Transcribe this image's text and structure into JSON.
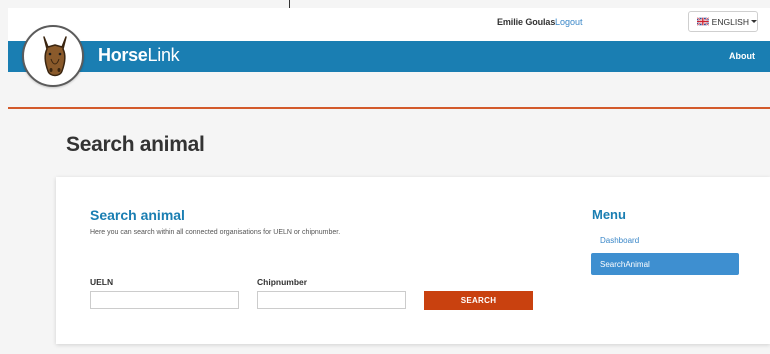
{
  "topbar": {
    "user_name": "Emilie Goulas",
    "logout_label": "Logout",
    "language_label": "ENGLISH"
  },
  "navbar": {
    "brand_bold": "Horse",
    "brand_light": "Link",
    "about_label": "About"
  },
  "page": {
    "title": "Search animal"
  },
  "search_card": {
    "title": "Search animal",
    "description": "Here you can search within all connected organisations for UELN or chipnumber.",
    "ueln_label": "UELN",
    "ueln_value": "",
    "chip_label": "Chipnumber",
    "chip_value": "",
    "search_label": "SEARCH"
  },
  "menu": {
    "title": "Menu",
    "items": [
      {
        "label": "Dashboard",
        "active": false
      },
      {
        "label": "SearchAnimal",
        "active": true
      }
    ]
  },
  "colors": {
    "brand_blue": "#1a7eb2",
    "accent_orange": "#c9410f",
    "menu_active": "#3e8fd0",
    "link_blue": "#3a87c8"
  }
}
